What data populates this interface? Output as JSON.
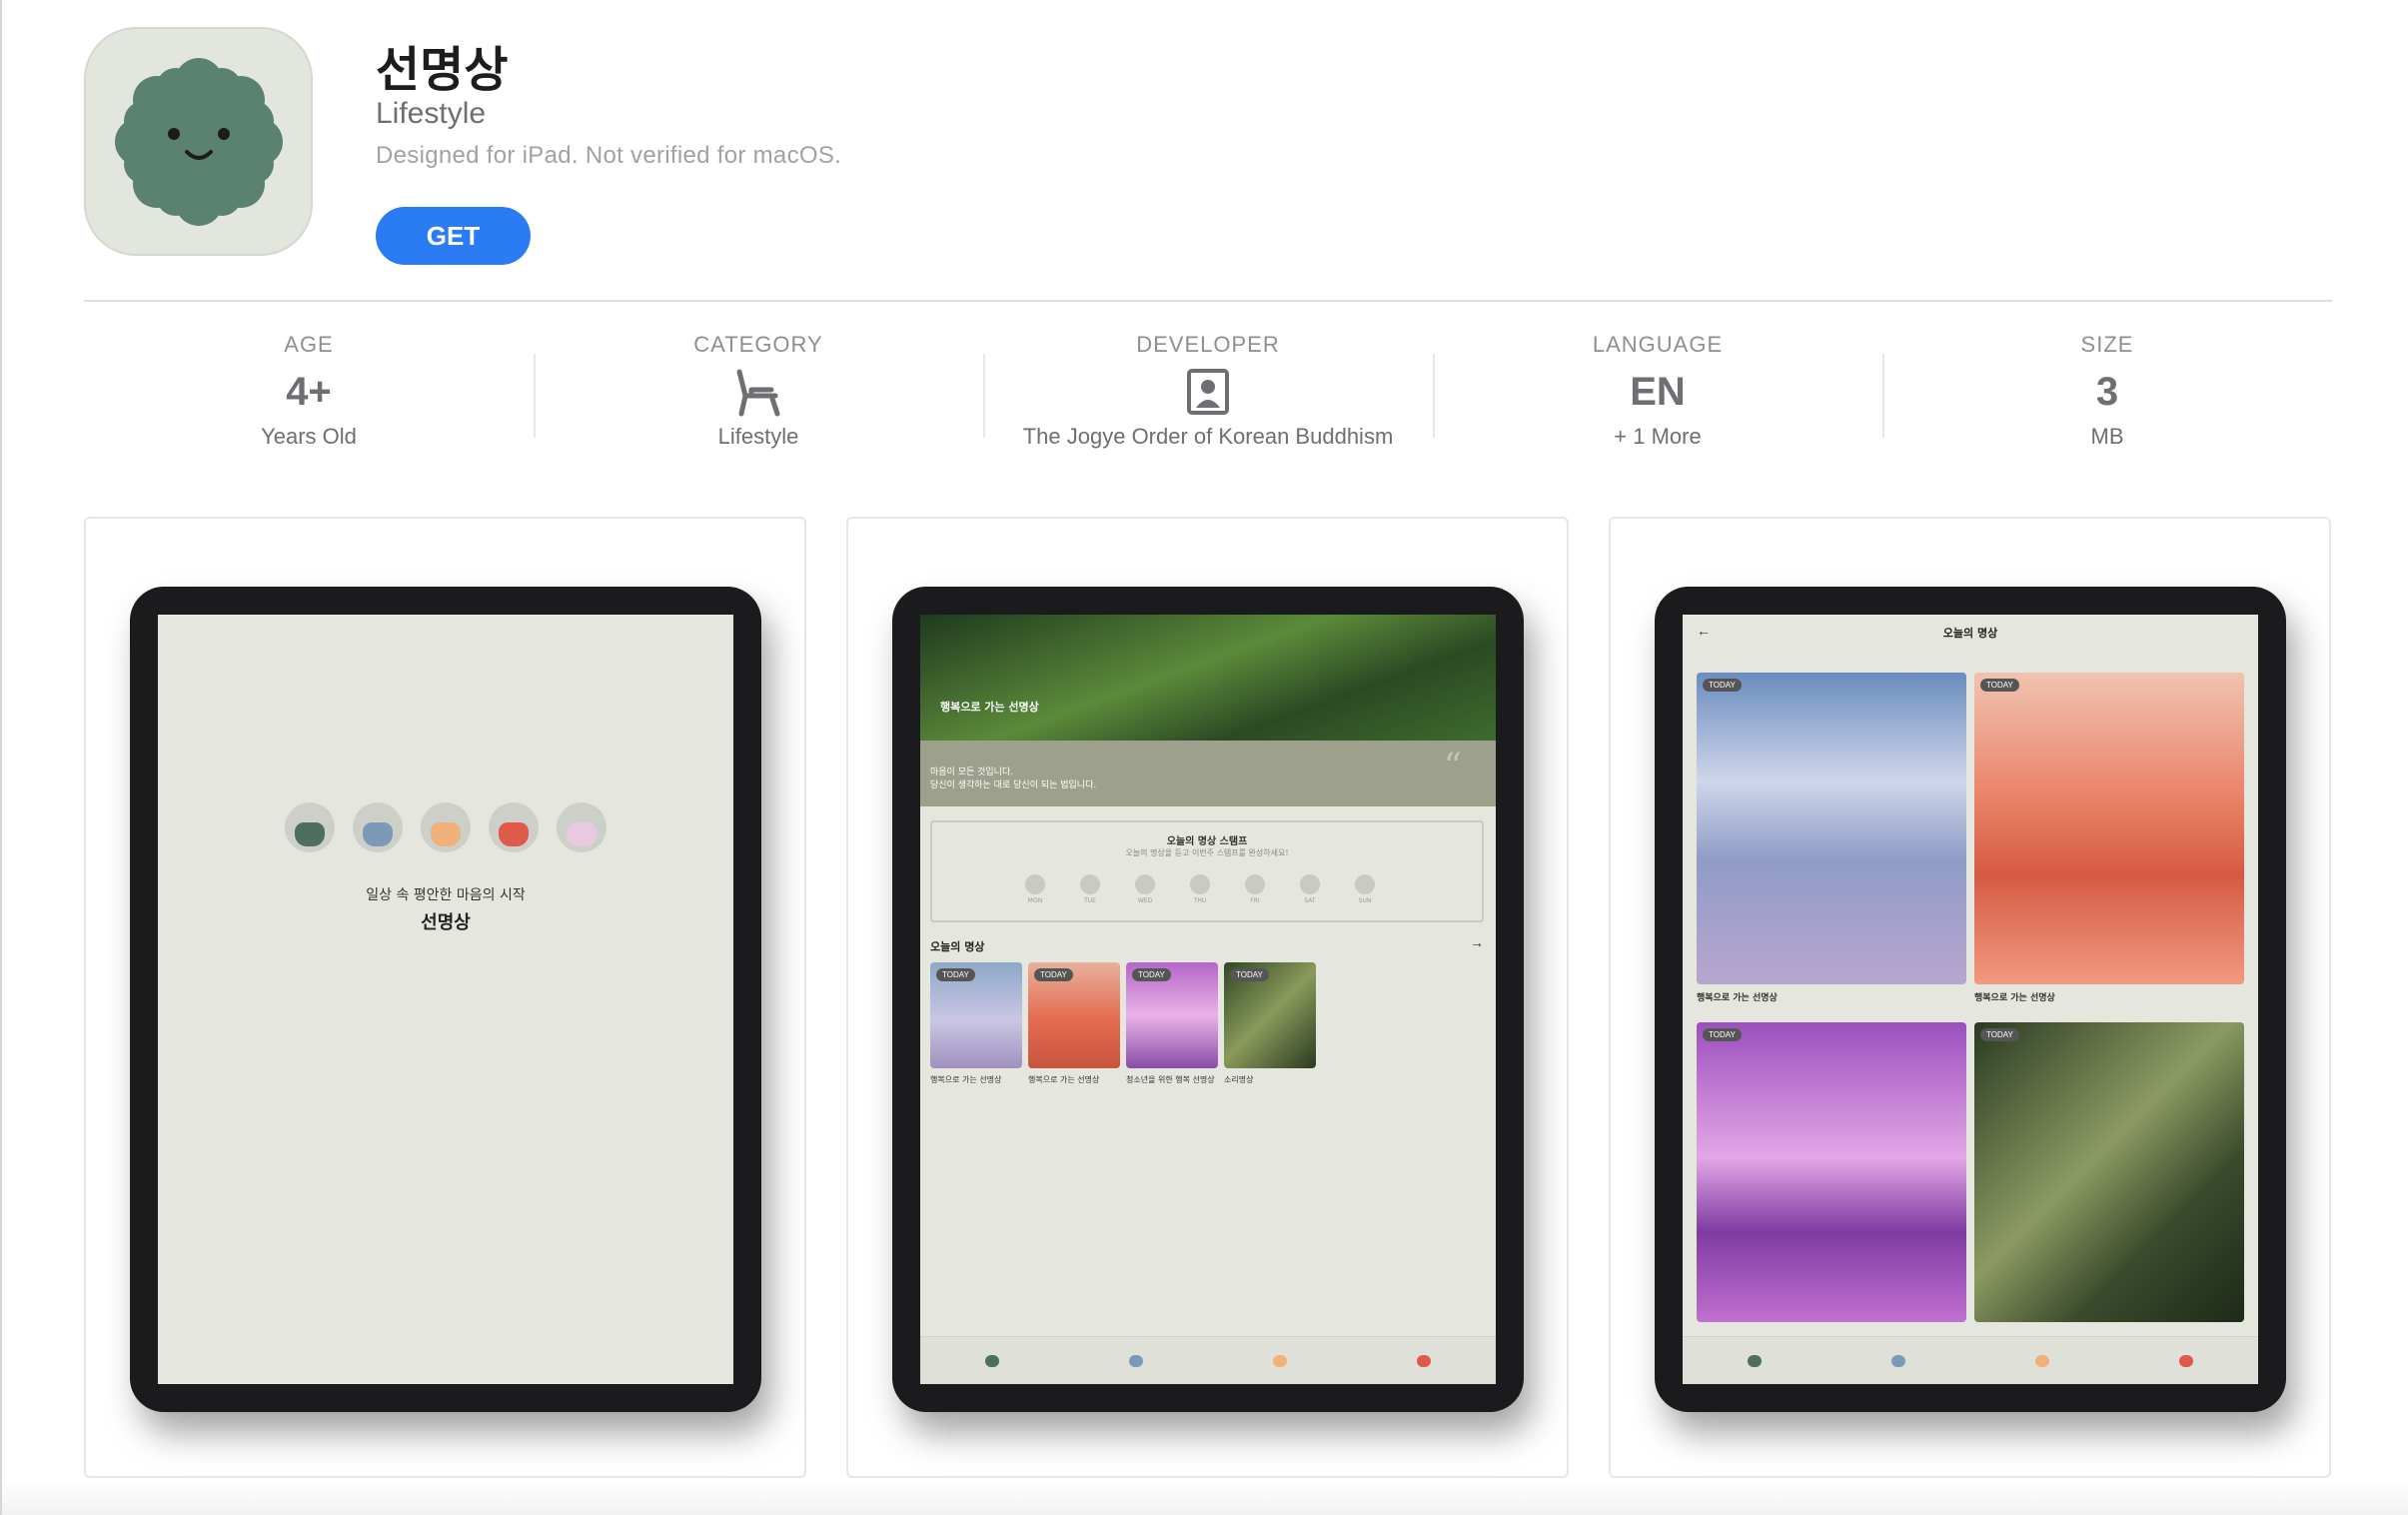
{
  "app": {
    "title": "선명상",
    "category": "Lifestyle",
    "designed": "Designed for iPad. Not verified for macOS.",
    "get": "GET"
  },
  "info": [
    {
      "label": "AGE",
      "value": "4+",
      "sub": "Years Old"
    },
    {
      "label": "CATEGORY",
      "value": "",
      "icon": "chair-icon",
      "sub": "Lifestyle"
    },
    {
      "label": "DEVELOPER",
      "value": "",
      "icon": "person-icon",
      "sub": "The Jogye Order of Korean Buddhism"
    },
    {
      "label": "LANGUAGE",
      "value": "EN",
      "sub": "+ 1 More"
    },
    {
      "label": "SIZE",
      "value": "3",
      "sub": "MB"
    }
  ],
  "shot1": {
    "line1": "일상 속 평안한 마음의 시작",
    "line2": "선명상"
  },
  "shot2": {
    "hero_title": "행복으로 가는 선명상",
    "quote_lines": [
      "마음이 모든 것입니다.",
      "당신이 생각하는 대로 당신이 되는 법입니다."
    ],
    "stamp_title": "오늘의 명상 스탬프",
    "stamp_sub": "오늘의 명상을 듣고 이번주 스탬프를 완성하세요!",
    "days": [
      "MON",
      "TUE",
      "WED",
      "THU",
      "FRI",
      "SAT",
      "SUN"
    ],
    "section": "오늘의 명상",
    "cards": [
      "행복으로 가는 선명상",
      "행복으로 가는 선명상",
      "청소년을 위한 행복 선명상",
      "소리명상"
    ],
    "tag": "TODAY"
  },
  "shot3": {
    "header": "오늘의 명상",
    "cards": [
      "행복으로 가는 선명상",
      "행복으로 가는 선명상"
    ],
    "tag": "TODAY"
  },
  "colors": {
    "accent": "#2b7bf4",
    "icon_bg": "#e2e6dc",
    "mascot": "#5b8271",
    "screen_bg": "#e5e6de"
  }
}
